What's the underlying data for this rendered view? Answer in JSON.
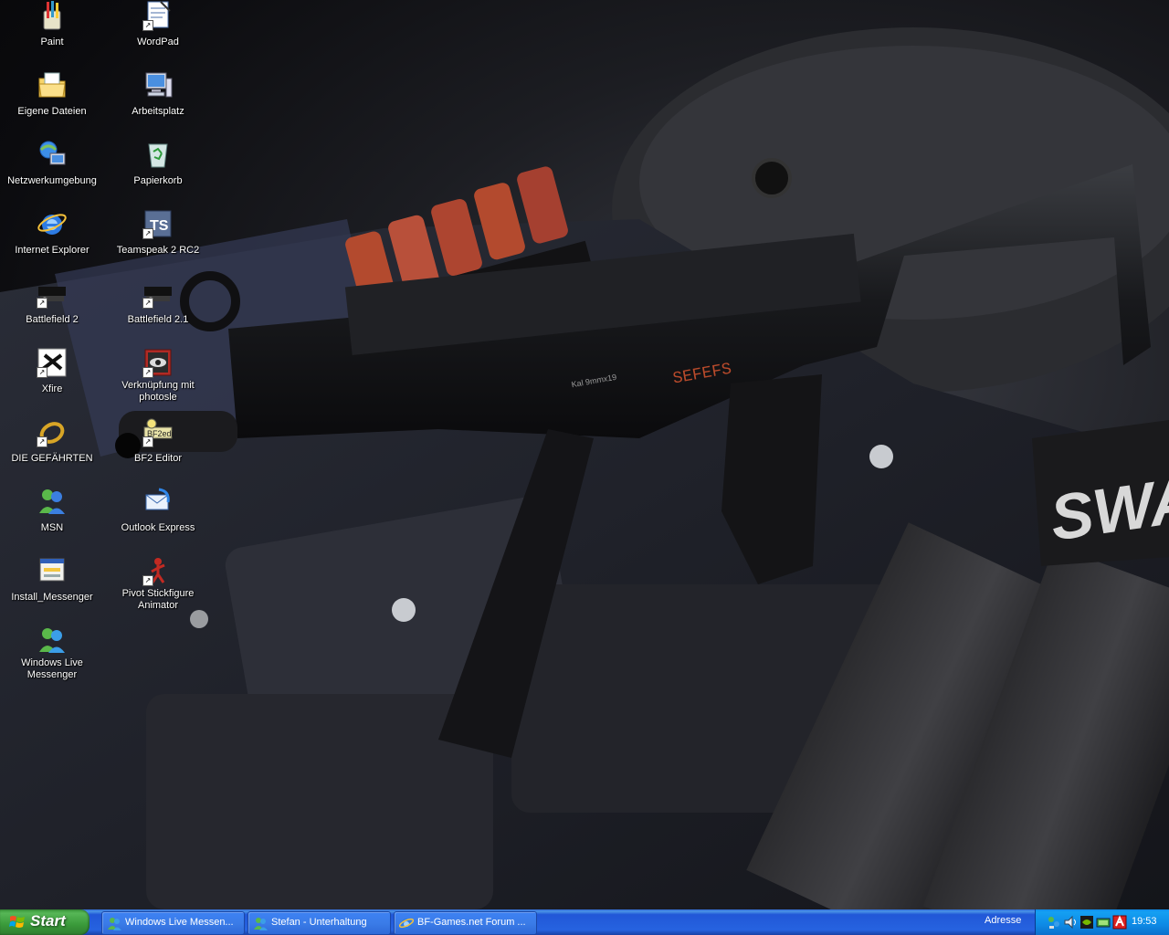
{
  "desktop": {
    "icons": [
      {
        "label": "Paint",
        "icon": "paint-icon",
        "shortcut": false
      },
      {
        "label": "WordPad",
        "icon": "wordpad-icon",
        "shortcut": true
      },
      {
        "label": "Eigene Dateien",
        "icon": "my-documents-icon",
        "shortcut": false
      },
      {
        "label": "Arbeitsplatz",
        "icon": "my-computer-icon",
        "shortcut": false
      },
      {
        "label": "Netzwerkumgebung",
        "icon": "network-places-icon",
        "shortcut": false
      },
      {
        "label": "Papierkorb",
        "icon": "recycle-bin-icon",
        "shortcut": false
      },
      {
        "label": "Internet Explorer",
        "icon": "internet-explorer-icon",
        "shortcut": false
      },
      {
        "label": "Teamspeak 2 RC2",
        "icon": "teamspeak-icon",
        "shortcut": true
      },
      {
        "label": "Battlefield 2",
        "icon": "battlefield-icon",
        "shortcut": true
      },
      {
        "label": "Battlefield 2.1",
        "icon": "battlefield-icon",
        "shortcut": true
      },
      {
        "label": "Xfire",
        "icon": "xfire-icon",
        "shortcut": true
      },
      {
        "label": "Verknüpfung mit photosle",
        "icon": "photosle-icon",
        "shortcut": true
      },
      {
        "label": "DIE GEFÄHRTEN",
        "icon": "ring-icon",
        "shortcut": true
      },
      {
        "label": "BF2 Editor",
        "icon": "bf2-editor-icon",
        "shortcut": true
      },
      {
        "label": "MSN",
        "icon": "msn-icon",
        "shortcut": false
      },
      {
        "label": "Outlook Express",
        "icon": "outlook-express-icon",
        "shortcut": false
      },
      {
        "label": "Install_Messenger",
        "icon": "installer-icon",
        "shortcut": false
      },
      {
        "label": "Pivot Stickfigure Animator",
        "icon": "stickfigure-icon",
        "shortcut": true
      },
      {
        "label": "Windows Live Messenger",
        "icon": "live-messenger-icon",
        "shortcut": false
      }
    ]
  },
  "taskbar": {
    "start_label": "Start",
    "tasks": [
      {
        "label": "Windows Live Messen...",
        "icon": "live-messenger-icon",
        "active": false
      },
      {
        "label": "Stefan - Unterhaltung",
        "icon": "messenger-chat-icon",
        "active": false
      },
      {
        "label": "BF-Games.net Forum ...",
        "icon": "internet-explorer-icon",
        "active": false
      }
    ],
    "address_label": "Adresse",
    "tray_icons": [
      "network-icon",
      "volume-icon",
      "nvidia-icon",
      "graphics-icon",
      "antivirus-icon"
    ],
    "clock": "19:53"
  }
}
